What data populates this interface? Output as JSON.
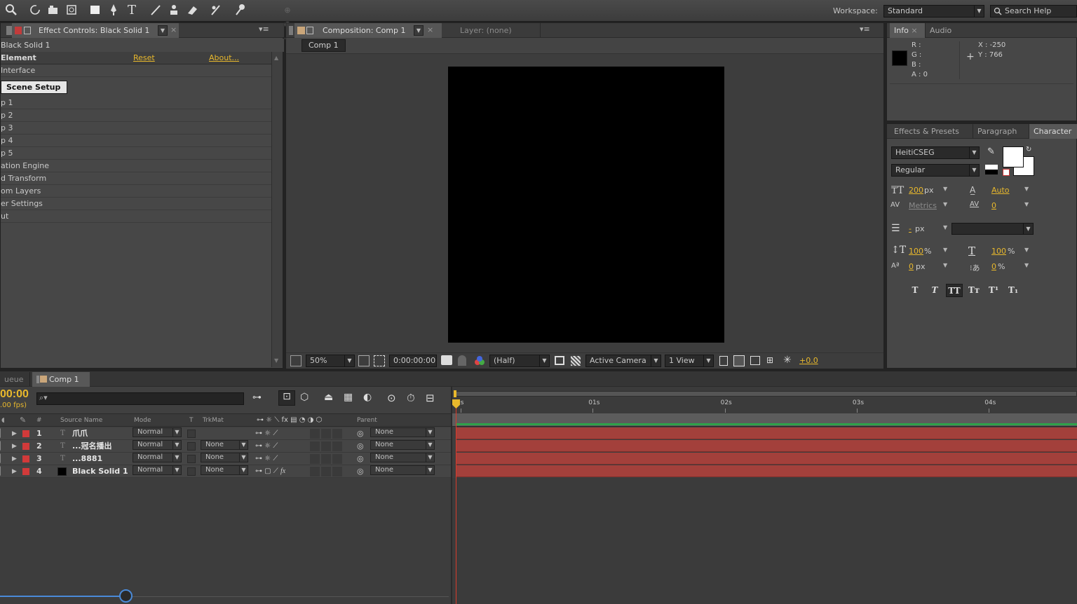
{
  "toolbar": {
    "tools": [
      "search-icon",
      "rotate-icon",
      "camera-orbit-icon",
      "pan-behind-icon",
      "rectangle-icon",
      "pen-icon",
      "type-icon",
      "brush-icon",
      "clone-stamp-icon",
      "eraser-icon",
      "roto-brush-icon",
      "puppet-pin-icon"
    ],
    "workspace_label": "Workspace:",
    "workspace_value": "Standard",
    "search_placeholder": "Search Help"
  },
  "effect_controls": {
    "tab_label": "Effect Controls: Black Solid 1",
    "subtitle": "Black Solid 1",
    "effect_name": "Element",
    "reset_label": "Reset",
    "about_label": "About...",
    "interface_label": "Interface",
    "scene_setup_button": "Scene Setup",
    "items": [
      "p 1",
      "p 2",
      "p 3",
      "p 4",
      "p 5",
      "ation Engine",
      "d Transform",
      "om Layers",
      "er Settings",
      "ut"
    ]
  },
  "composition": {
    "tab_label": "Composition: Comp 1",
    "layer_tab_label": "Layer: (none)",
    "sub_tab": "Comp 1",
    "zoom": "50%",
    "timecode": "0:00:00:00",
    "resolution": "(Half)",
    "camera": "Active Camera",
    "views": "1 View",
    "exposure": "+0.0"
  },
  "info_panel": {
    "tab_info": "Info",
    "tab_audio": "Audio",
    "r_label": "R :",
    "g_label": "G :",
    "b_label": "B :",
    "a_label": "A : 0",
    "x_label": "X : -250",
    "y_label": "Y : 766"
  },
  "character_panel": {
    "tab_effects": "Effects & Presets",
    "tab_paragraph": "Paragraph",
    "tab_character": "Character",
    "font_family": "HeitiCSEG",
    "font_style": "Regular",
    "font_size": "200",
    "font_size_unit": "px",
    "leading": "Auto",
    "kerning": "Metrics",
    "tracking": "0",
    "stroke_width": "-",
    "stroke_unit": "px",
    "vert_scale": "100",
    "horiz_scale": "100",
    "baseline": "0",
    "baseline_unit": "px",
    "tsume": "0",
    "percent": "%",
    "style_buttons": [
      "T",
      "T",
      "TT",
      "Tт",
      "T¹",
      "T₁"
    ]
  },
  "timeline": {
    "tab_queue": "ueue",
    "tab_comp": "Comp 1",
    "timecode": "00:00",
    "fps": ".00 fps)",
    "ruler": [
      "0s",
      "01s",
      "02s",
      "03s",
      "04s"
    ],
    "columns": {
      "num": "#",
      "source_name": "Source Name",
      "mode": "Mode",
      "t": "T",
      "trkmat": "TrkMat",
      "parent": "Parent"
    },
    "layers": [
      {
        "num": "1",
        "name": "爪爪",
        "mode": "Normal",
        "trkmat": "",
        "parent": "None",
        "type": "text"
      },
      {
        "num": "2",
        "name": "...冠名播出",
        "mode": "Normal",
        "trkmat": "None",
        "parent": "None",
        "type": "text"
      },
      {
        "num": "3",
        "name": "...8881",
        "mode": "Normal",
        "trkmat": "None",
        "parent": "None",
        "type": "text"
      },
      {
        "num": "4",
        "name": "Black Solid 1",
        "mode": "Normal",
        "trkmat": "None",
        "parent": "None",
        "type": "solid"
      }
    ]
  },
  "colors": {
    "accent": "#e8b82c",
    "layer_bar": "#a3403b",
    "label_red": "#d23a3a",
    "work_area_green": "#2fa14a",
    "playhead": "#d83b2b"
  }
}
